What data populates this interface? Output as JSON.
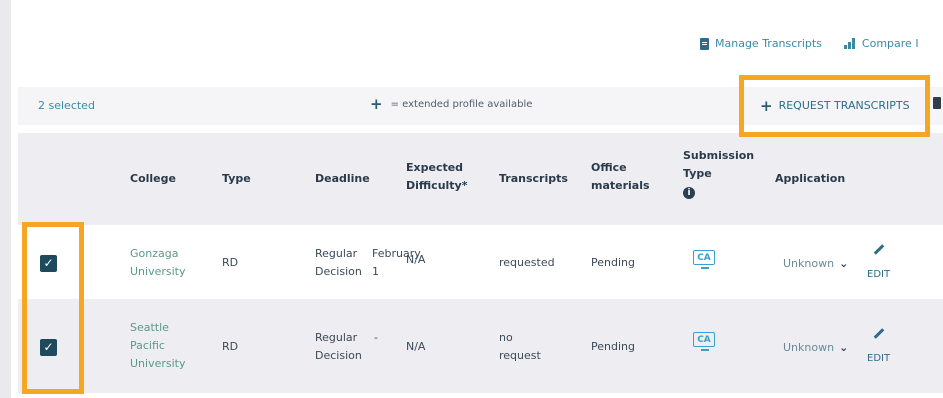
{
  "toplinks": {
    "manage": "Manage Transcripts",
    "compare": "Compare I"
  },
  "toolbar": {
    "selected": "2 selected",
    "legend": "= extended profile available",
    "request": "REQUEST TRANSCRIPTS"
  },
  "headers": {
    "college": "College",
    "type": "Type",
    "deadline": "Deadline",
    "difficulty1": "Expected",
    "difficulty2": "Difficulty*",
    "transcripts": "Transcripts",
    "office1": "Office",
    "office2": "materials",
    "submission1": "Submission",
    "submission2": "Type",
    "application": "Application"
  },
  "rows": [
    {
      "checked": true,
      "college": [
        "Gonzaga",
        "University"
      ],
      "type": "RD",
      "deadline": [
        "Regular",
        "Decision"
      ],
      "deadline_date": [
        "February",
        "1"
      ],
      "difficulty": "N/A",
      "transcripts": [
        "requested"
      ],
      "office": "Pending",
      "submission_icon": "CA",
      "application": "Unknown",
      "edit": "EDIT"
    },
    {
      "checked": true,
      "college": [
        "Seattle",
        "Pacific",
        "University"
      ],
      "type": "RD",
      "deadline": [
        "Regular",
        "Decision"
      ],
      "deadline_date": [
        "-",
        ""
      ],
      "difficulty": "N/A",
      "transcripts": [
        "no",
        "request"
      ],
      "office": "Pending",
      "submission_icon": "CA",
      "application": "Unknown",
      "edit": "EDIT"
    }
  ],
  "colors": {
    "highlight": "#f5a623",
    "link": "#3b8aa3",
    "checkbox": "#1f4a5e"
  },
  "icons": [
    "document-icon",
    "bar-chart-icon",
    "plus-icon",
    "trash-icon",
    "info-icon",
    "common-app-icon",
    "chevron-down-icon",
    "pencil-icon",
    "checkmark-icon"
  ]
}
